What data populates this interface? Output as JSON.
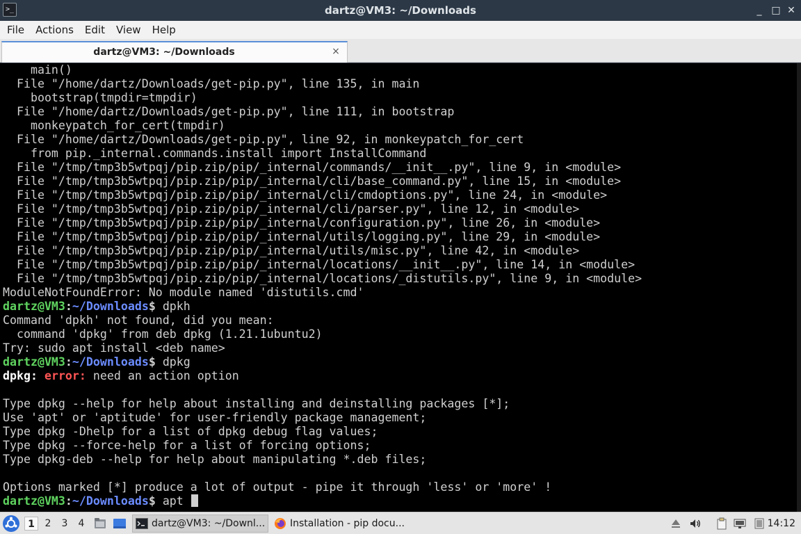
{
  "window": {
    "title": "dartz@VM3: ~/Downloads",
    "controls": {
      "minimize": "_",
      "maximize": "□",
      "close": "✕"
    }
  },
  "menu": {
    "file": "File",
    "actions": "Actions",
    "edit": "Edit",
    "view": "View",
    "help": "Help"
  },
  "tab": {
    "label": "dartz@VM3: ~/Downloads",
    "close": "×"
  },
  "prompt": {
    "user": "dartz@VM3",
    "colon": ":",
    "path": "~/Downloads",
    "dollar": "$"
  },
  "terminal": {
    "l01": "    main()",
    "l02": "  File \"/home/dartz/Downloads/get-pip.py\", line 135, in main",
    "l03": "    bootstrap(tmpdir=tmpdir)",
    "l04": "  File \"/home/dartz/Downloads/get-pip.py\", line 111, in bootstrap",
    "l05": "    monkeypatch_for_cert(tmpdir)",
    "l06": "  File \"/home/dartz/Downloads/get-pip.py\", line 92, in monkeypatch_for_cert",
    "l07": "    from pip._internal.commands.install import InstallCommand",
    "l08": "  File \"/tmp/tmp3b5wtpqj/pip.zip/pip/_internal/commands/__init__.py\", line 9, in <module>",
    "l09": "  File \"/tmp/tmp3b5wtpqj/pip.zip/pip/_internal/cli/base_command.py\", line 15, in <module>",
    "l10": "  File \"/tmp/tmp3b5wtpqj/pip.zip/pip/_internal/cli/cmdoptions.py\", line 24, in <module>",
    "l11": "  File \"/tmp/tmp3b5wtpqj/pip.zip/pip/_internal/cli/parser.py\", line 12, in <module>",
    "l12": "  File \"/tmp/tmp3b5wtpqj/pip.zip/pip/_internal/configuration.py\", line 26, in <module>",
    "l13": "  File \"/tmp/tmp3b5wtpqj/pip.zip/pip/_internal/utils/logging.py\", line 29, in <module>",
    "l14": "  File \"/tmp/tmp3b5wtpqj/pip.zip/pip/_internal/utils/misc.py\", line 42, in <module>",
    "l15": "  File \"/tmp/tmp3b5wtpqj/pip.zip/pip/_internal/locations/__init__.py\", line 14, in <module>",
    "l16": "  File \"/tmp/tmp3b5wtpqj/pip.zip/pip/_internal/locations/_distutils.py\", line 9, in <module>",
    "l17": "ModuleNotFoundError: No module named 'distutils.cmd'",
    "cmd1": " dpkh",
    "l19": "Command 'dpkh' not found, did you mean:",
    "l20": "  command 'dpkg' from deb dpkg (1.21.1ubuntu2)",
    "l21": "Try: sudo apt install <deb name>",
    "cmd2": " dpkg",
    "err_prog": "dpkg:",
    "err_word": "error:",
    "err_msg": " need an action option",
    "l25": "Type dpkg --help for help about installing and deinstalling packages [*];",
    "l26": "Use 'apt' or 'aptitude' for user-friendly package management;",
    "l27": "Type dpkg -Dhelp for a list of dpkg debug flag values;",
    "l28": "Type dpkg --force-help for a list of forcing options;",
    "l29": "Type dpkg-deb --help for help about manipulating *.deb files;",
    "l31": "Options marked [*] produce a lot of output - pipe it through 'less' or 'more' !",
    "cmd3": " apt "
  },
  "taskbar": {
    "workspaces": [
      "1",
      "2",
      "3",
      "4"
    ],
    "tasks": [
      {
        "label": "dartz@VM3: ~/Downl..."
      },
      {
        "label": "Installation - pip docu..."
      }
    ],
    "clock": "14:12"
  }
}
